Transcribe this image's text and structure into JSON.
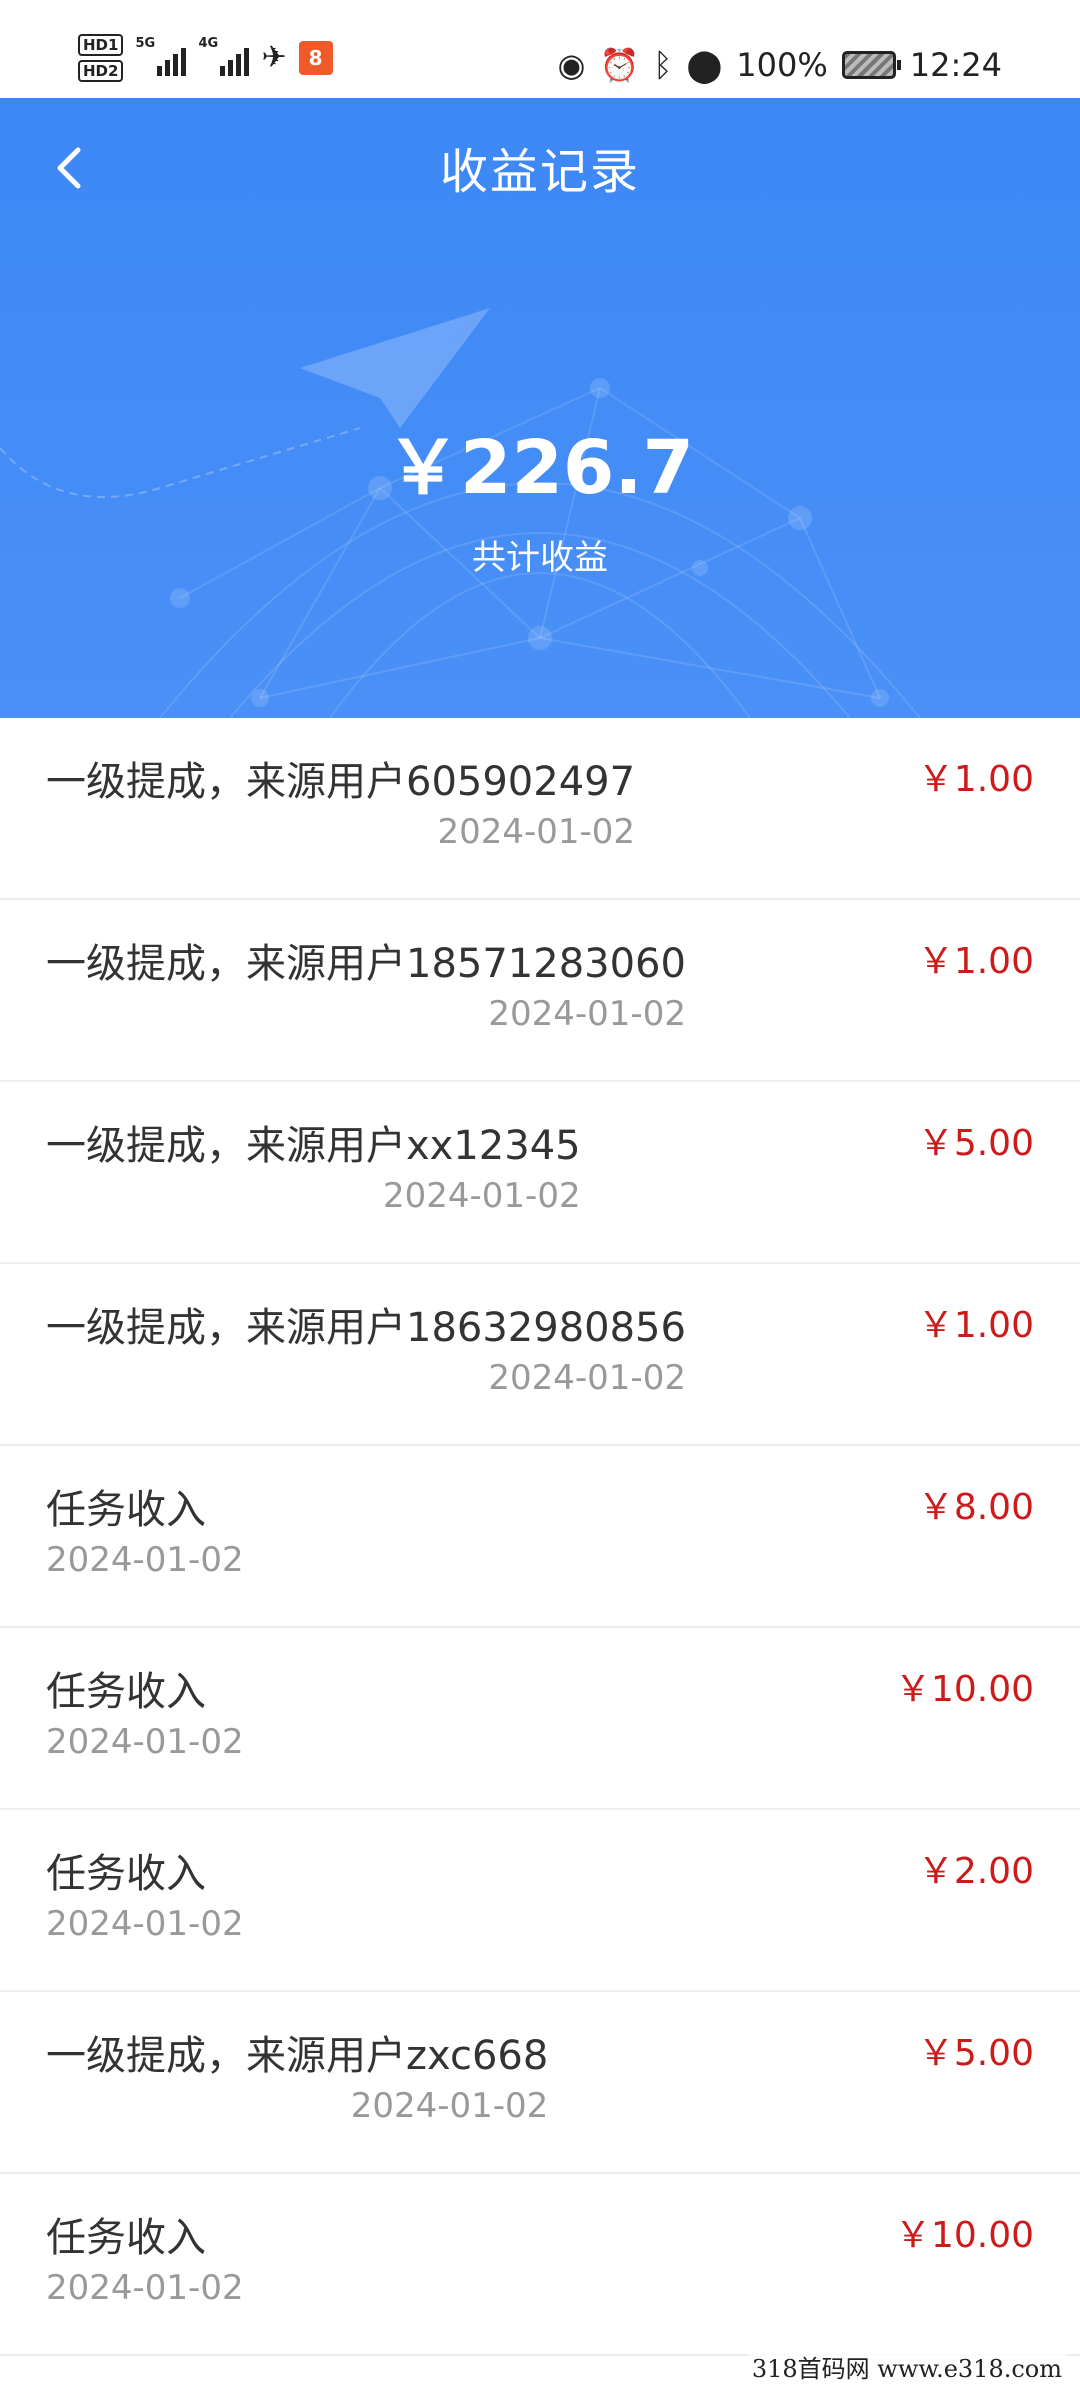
{
  "status_bar": {
    "hd1": "HD1",
    "hd2": "HD2",
    "net1": "5G",
    "net2": "4G",
    "app_icon_glyph": "8",
    "battery_percent": "100%",
    "time": "12:24",
    "icons": [
      "eye-icon",
      "alarm-icon",
      "bluetooth-icon",
      "location-icon",
      "airplane-icon"
    ]
  },
  "header": {
    "title": "收益记录",
    "total_amount": "￥226.7",
    "total_label": "共计收益",
    "background_color": "#3d88f6"
  },
  "records": [
    {
      "desc": "一级提成，来源用户605902497",
      "date": "2024-01-02",
      "amount": "￥1.00"
    },
    {
      "desc": "一级提成，来源用户18571283060",
      "date": "2024-01-02",
      "amount": "￥1.00"
    },
    {
      "desc": "一级提成，来源用户xx12345",
      "date": "2024-01-02",
      "amount": "￥5.00"
    },
    {
      "desc": "一级提成，来源用户18632980856",
      "date": "2024-01-02",
      "amount": "￥1.00"
    },
    {
      "desc": "任务收入",
      "date": "2024-01-02",
      "amount": "￥8.00"
    },
    {
      "desc": "任务收入",
      "date": "2024-01-02",
      "amount": "￥10.00"
    },
    {
      "desc": "任务收入",
      "date": "2024-01-02",
      "amount": "￥2.00"
    },
    {
      "desc": "一级提成，来源用户zxc668",
      "date": "2024-01-02",
      "amount": "￥5.00"
    },
    {
      "desc": "任务收入",
      "date": "2024-01-02",
      "amount": "￥10.00"
    }
  ],
  "amount_color": "#cc1b1b",
  "watermark": "318首码网  www.e318.com"
}
